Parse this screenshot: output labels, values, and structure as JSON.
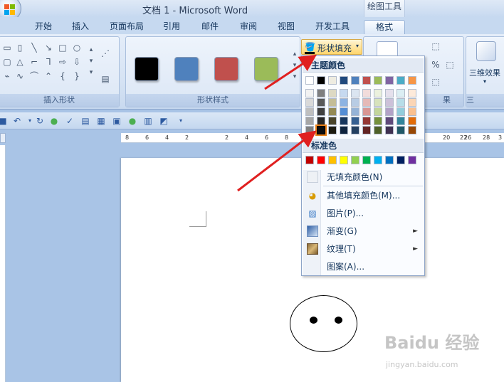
{
  "window": {
    "title": "文档 1 - Microsoft Word",
    "tools_tab": "绘图工具"
  },
  "tabs": [
    {
      "label": "开始"
    },
    {
      "label": "插入"
    },
    {
      "label": "页面布局"
    },
    {
      "label": "引用"
    },
    {
      "label": "邮件"
    },
    {
      "label": "审阅"
    },
    {
      "label": "视图"
    },
    {
      "label": "开发工具"
    },
    {
      "label": "格式"
    }
  ],
  "active_tab": "格式",
  "ribbon": {
    "insert_shapes_label": "插入形状",
    "shape_styles_label": "形状样式",
    "shape_fill_button": "形状填充",
    "effects_group_fragment": "果",
    "threed_effects_label": "三维效果",
    "threed_group_fragment": "三",
    "style_swatches": [
      "#000000",
      "#4f81bd",
      "#c0504d",
      "#9bbb59"
    ]
  },
  "ruler": {
    "ticks": [
      "8",
      "6",
      "4",
      "2",
      "2",
      "4",
      "6",
      "8",
      "20",
      "22",
      "26",
      "28",
      "3"
    ]
  },
  "fill_menu": {
    "theme_colors_header": "主题颜色",
    "theme_top_row": [
      "#ffffff",
      "#000000",
      "#eeece1",
      "#1f497d",
      "#4f81bd",
      "#c0504d",
      "#9bbb59",
      "#8064a2",
      "#4bacc6",
      "#f79646"
    ],
    "theme_shade_columns": [
      [
        "#f2f2f2",
        "#d9d9d9",
        "#bfbfbf",
        "#a6a6a6",
        "#808080"
      ],
      [
        "#7f7f7f",
        "#595959",
        "#404040",
        "#262626",
        "#0d0d0d"
      ],
      [
        "#ddd9c3",
        "#c4bd97",
        "#948a54",
        "#4a452a",
        "#1d1b10"
      ],
      [
        "#c6d9f0",
        "#8db3e2",
        "#548dd4",
        "#17365d",
        "#0f243e"
      ],
      [
        "#dbe5f1",
        "#b8cce4",
        "#95b3d7",
        "#366092",
        "#244061"
      ],
      [
        "#f2dcdb",
        "#e5b9b7",
        "#d99694",
        "#953734",
        "#632423"
      ],
      [
        "#ebf1dd",
        "#d7e3bc",
        "#c3d69b",
        "#76923c",
        "#4f6128"
      ],
      [
        "#e5e0ec",
        "#ccc1d9",
        "#b2a2c7",
        "#5f497a",
        "#3f3151"
      ],
      [
        "#dbeef3",
        "#b7dde8",
        "#92cddc",
        "#31859b",
        "#205867"
      ],
      [
        "#fdeada",
        "#fbd5b5",
        "#fac08f",
        "#e36c09",
        "#974806"
      ]
    ],
    "standard_colors_header": "标准色",
    "standard_colors": [
      "#c00000",
      "#ff0000",
      "#ffc000",
      "#ffff00",
      "#92d050",
      "#00b050",
      "#00b0f0",
      "#0070c0",
      "#002060",
      "#7030a0"
    ],
    "items": [
      {
        "label": "无填充颜色(N)",
        "icon": "no-fill-icon",
        "submenu": false
      },
      {
        "label": "其他填充颜色(M)...",
        "icon": "palette-icon",
        "submenu": false
      },
      {
        "label": "图片(P)...",
        "icon": "picture-icon",
        "submenu": false
      },
      {
        "label": "渐变(G)",
        "icon": "gradient-icon",
        "submenu": true
      },
      {
        "label": "纹理(T)",
        "icon": "texture-icon",
        "submenu": true
      },
      {
        "label": "图案(A)...",
        "icon": "pattern-icon",
        "submenu": false
      }
    ]
  },
  "watermark": {
    "logo": "Baidu 经验",
    "url": "jingyan.baidu.com"
  },
  "colors": {
    "annotation_arrow": "#e02020",
    "selection_highlight": "#e8801a"
  }
}
